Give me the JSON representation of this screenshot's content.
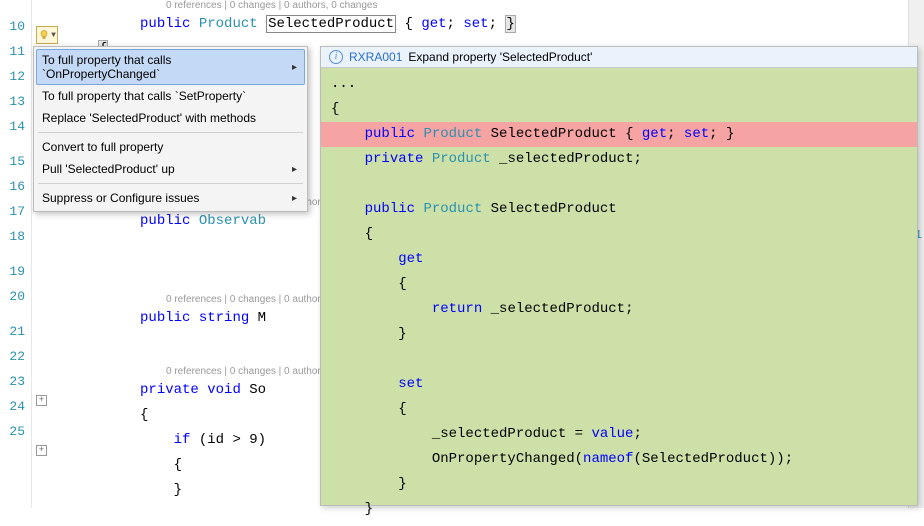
{
  "gutter": [
    "10",
    "11",
    "12",
    "13",
    "14",
    "",
    "15",
    "16",
    "17",
    "18",
    "",
    "19",
    "20",
    "",
    "21",
    "22",
    "23",
    "24",
    "25"
  ],
  "codelens": "0 references | 0 changes | 0 authors, 0 changes",
  "codelens_short": "0 references | 0 changes | 0 author",
  "code": {
    "l10": {
      "kw": "public",
      "type": "Product",
      "ident": "SelectedProduct",
      "rest": " { get; set; }"
    },
    "l11_brace": "{",
    "l16": {
      "kw": "public",
      "type": "Observab"
    },
    "l19": {
      "kw": "public",
      "type": "string",
      "ident": "M"
    },
    "l21": {
      "kw": "private",
      "type": "void",
      "ident": "So"
    },
    "l22": "{",
    "l23": {
      "kw": "if",
      "cond": " (id > 9)"
    },
    "l24": "{",
    "l25": "}"
  },
  "menu": {
    "items": [
      {
        "label": "To full property that calls `OnPropertyChanged`",
        "arrow": true,
        "selected": true
      },
      {
        "label": "To full property that calls `SetProperty`",
        "arrow": false
      },
      {
        "label": "Replace 'SelectedProduct' with methods",
        "arrow": false
      },
      {
        "label": "Convert to full property",
        "arrow": false
      },
      {
        "label": "Pull 'SelectedProduct' up",
        "arrow": true
      },
      {
        "label": "Suppress or Configure issues",
        "arrow": true
      }
    ]
  },
  "preview": {
    "code": "RXRA001",
    "title": "Expand property 'SelectedProduct'",
    "lines": [
      {
        "t": "...",
        "cls": ""
      },
      {
        "t": "{",
        "cls": ""
      },
      {
        "t": "    public Product SelectedProduct { get; set; }",
        "cls": "removed",
        "tokens": [
          [
            "    ",
            ""
          ],
          [
            "public",
            "kw"
          ],
          [
            " ",
            ""
          ],
          [
            "Product",
            "type"
          ],
          [
            " SelectedProduct { ",
            ""
          ],
          [
            "get",
            "kw"
          ],
          [
            "; ",
            ""
          ],
          [
            "set",
            "kw"
          ],
          [
            "; }",
            ""
          ]
        ]
      },
      {
        "t": "    private Product _selectedProduct;",
        "tokens": [
          [
            "    ",
            ""
          ],
          [
            "private",
            "kw"
          ],
          [
            " ",
            ""
          ],
          [
            "Product",
            "type"
          ],
          [
            " _selectedProduct;",
            ""
          ]
        ]
      },
      {
        "t": "",
        "cls": ""
      },
      {
        "t": "    public Product SelectedProduct",
        "tokens": [
          [
            "    ",
            ""
          ],
          [
            "public",
            "kw"
          ],
          [
            " ",
            ""
          ],
          [
            "Product",
            "type"
          ],
          [
            " SelectedProduct",
            ""
          ]
        ]
      },
      {
        "t": "    {",
        "cls": ""
      },
      {
        "t": "        get",
        "tokens": [
          [
            "        ",
            ""
          ],
          [
            "get",
            "kw"
          ]
        ]
      },
      {
        "t": "        {",
        "cls": ""
      },
      {
        "t": "            return _selectedProduct;",
        "tokens": [
          [
            "            ",
            ""
          ],
          [
            "return",
            "kw"
          ],
          [
            " _selectedProduct;",
            ""
          ]
        ]
      },
      {
        "t": "        }",
        "cls": ""
      },
      {
        "t": "",
        "cls": ""
      },
      {
        "t": "        set",
        "tokens": [
          [
            "        ",
            ""
          ],
          [
            "set",
            "kw"
          ]
        ]
      },
      {
        "t": "        {",
        "cls": ""
      },
      {
        "t": "            _selectedProduct = value;",
        "tokens": [
          [
            "            _selectedProduct = ",
            ""
          ],
          [
            "value",
            "kw"
          ],
          [
            ";",
            ""
          ]
        ]
      },
      {
        "t": "            OnPropertyChanged(nameof(SelectedProduct));",
        "tokens": [
          [
            "            OnPropertyChanged(",
            ""
          ],
          [
            "nameof",
            "kw"
          ],
          [
            "(SelectedProduct));",
            ""
          ]
        ]
      },
      {
        "t": "        }",
        "cls": ""
      },
      {
        "t": "    }",
        "cls": ""
      }
    ]
  },
  "margin_mark": "1"
}
